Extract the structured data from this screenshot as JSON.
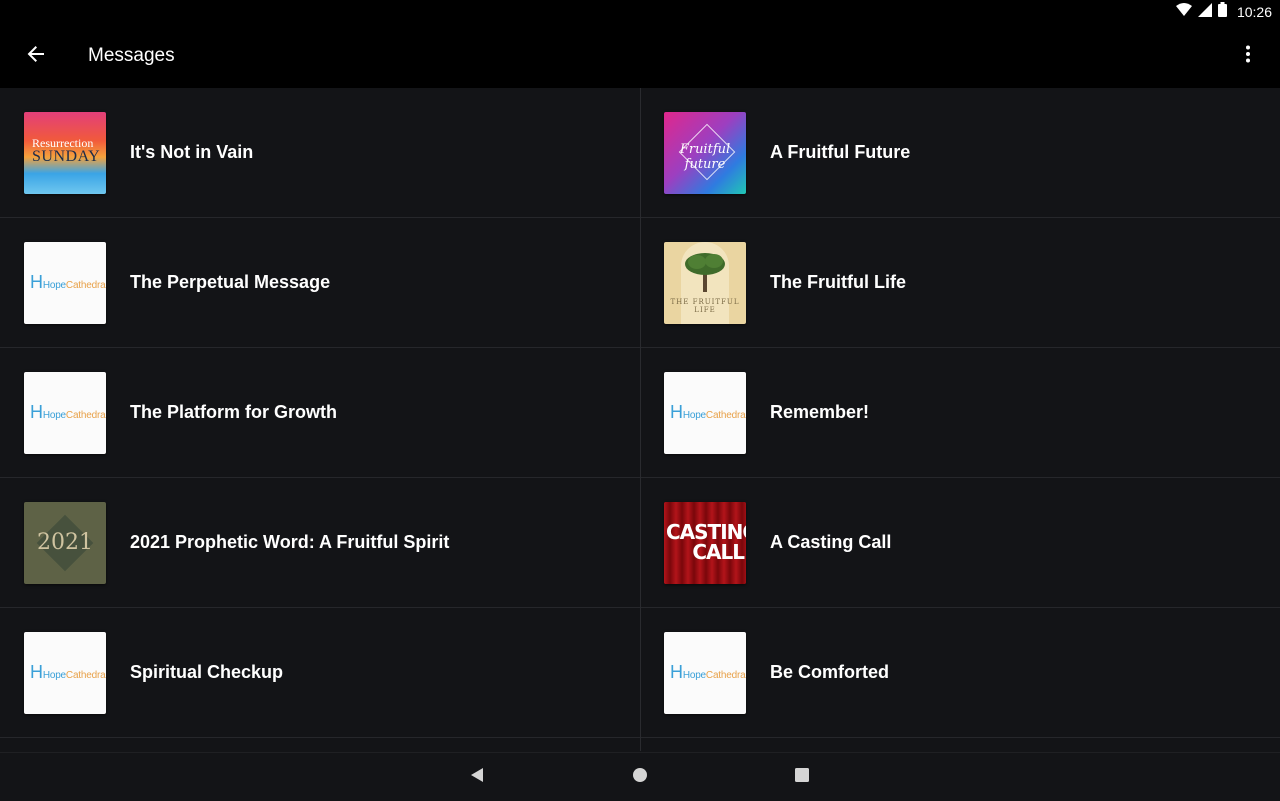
{
  "status_bar": {
    "time": "10:26",
    "icons": [
      "wifi-icon",
      "cell-signal-icon",
      "battery-icon"
    ]
  },
  "app_bar": {
    "title": "Messages",
    "back_icon": "arrow-back-icon",
    "menu_icon": "more-vert-icon"
  },
  "messages": [
    {
      "title": "It's Not in Vain",
      "thumbnail": "resurrection-sunday",
      "thumb_text": [
        "Resurrection",
        "SUNDAY"
      ]
    },
    {
      "title": "A Fruitful Future",
      "thumbnail": "fruitful-future",
      "thumb_text": [
        "Fruitful future"
      ]
    },
    {
      "title": "The Perpetual Message",
      "thumbnail": "hope-cathedral",
      "thumb_text": [
        "Hope",
        "Cathedral"
      ]
    },
    {
      "title": "The Fruitful Life",
      "thumbnail": "fruitful-life",
      "thumb_text": [
        "THE FRUITFUL LIFE"
      ]
    },
    {
      "title": "The Platform for Growth",
      "thumbnail": "hope-cathedral",
      "thumb_text": [
        "Hope",
        "Cathedral"
      ]
    },
    {
      "title": "Remember!",
      "thumbnail": "hope-cathedral",
      "thumb_text": [
        "Hope",
        "Cathedral"
      ]
    },
    {
      "title": "2021 Prophetic Word: A Fruitful Spirit",
      "thumbnail": "year-2021",
      "thumb_text": [
        "2021"
      ]
    },
    {
      "title": "A Casting Call",
      "thumbnail": "casting-call",
      "thumb_text": [
        "CASTING",
        "CALL"
      ]
    },
    {
      "title": "Spiritual Checkup",
      "thumbnail": "hope-cathedral",
      "thumb_text": [
        "Hope",
        "Cathedral"
      ]
    },
    {
      "title": "Be Comforted",
      "thumbnail": "hope-cathedral",
      "thumb_text": [
        "Hope",
        "Cathedral"
      ]
    }
  ],
  "nav_bar": {
    "icons": [
      "nav-back-icon",
      "nav-home-icon",
      "nav-recents-icon"
    ]
  }
}
